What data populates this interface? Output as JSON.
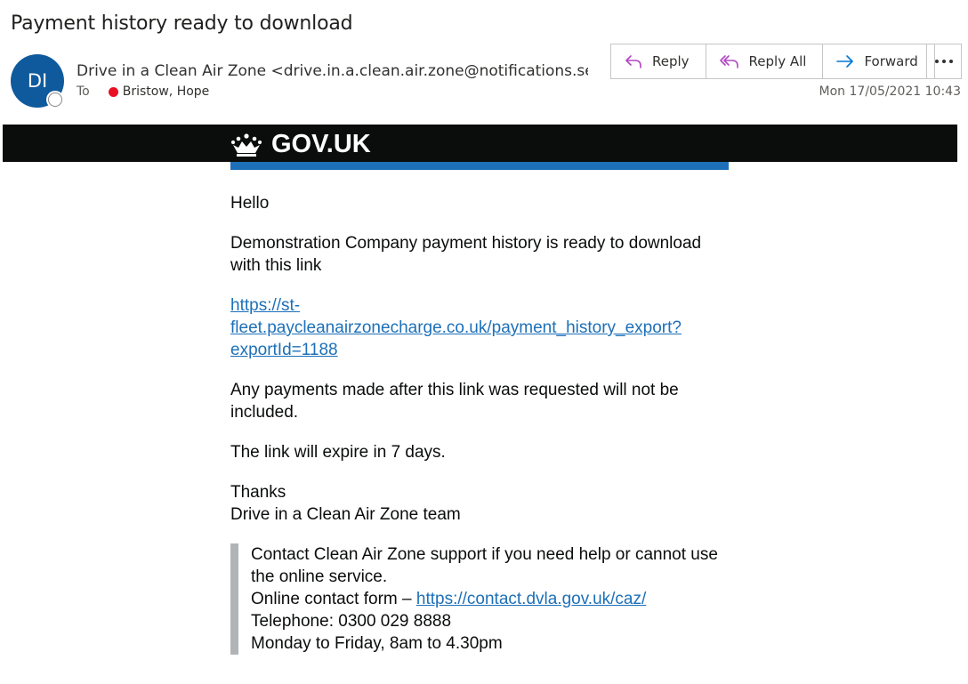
{
  "email": {
    "subject": "Payment history ready to download",
    "avatar_initials": "DI",
    "sender": "Drive in a Clean Air Zone <drive.in.a.clean.air.zone@notifications.service.gov.uk>",
    "to_label": "To",
    "recipient": "Bristow, Hope",
    "date": "Mon 17/05/2021 10:43"
  },
  "actions": {
    "reply": "Reply",
    "reply_all": "Reply All",
    "forward": "Forward",
    "more_icon": "more-icon"
  },
  "body": {
    "brand": "GOV.UK",
    "greeting": "Hello",
    "intro": "Demonstration Company payment history is ready to download with this link",
    "link": "https://st-fleet.paycleanairzonecharge.co.uk/payment_history_export?exportId=1188",
    "note": "Any payments made after this link was requested will not be included.",
    "expiry": "The link will expire in 7 days.",
    "thanks": "Thanks",
    "team": "Drive in a Clean Air Zone team",
    "support": {
      "intro": "Contact Clean Air Zone support if you need help or cannot use the online service.",
      "form_label": "Online contact form – ",
      "form_link": "https://contact.dvla.gov.uk/caz/",
      "telephone": "Telephone: 0300 029 8888",
      "hours": "Monday to Friday, 8am to 4.30pm"
    }
  },
  "colors": {
    "gov_black": "#0b0c0c",
    "gov_blue": "#1d70b8",
    "avatar_blue": "#0f5a9c",
    "presence_red": "#e81123"
  }
}
